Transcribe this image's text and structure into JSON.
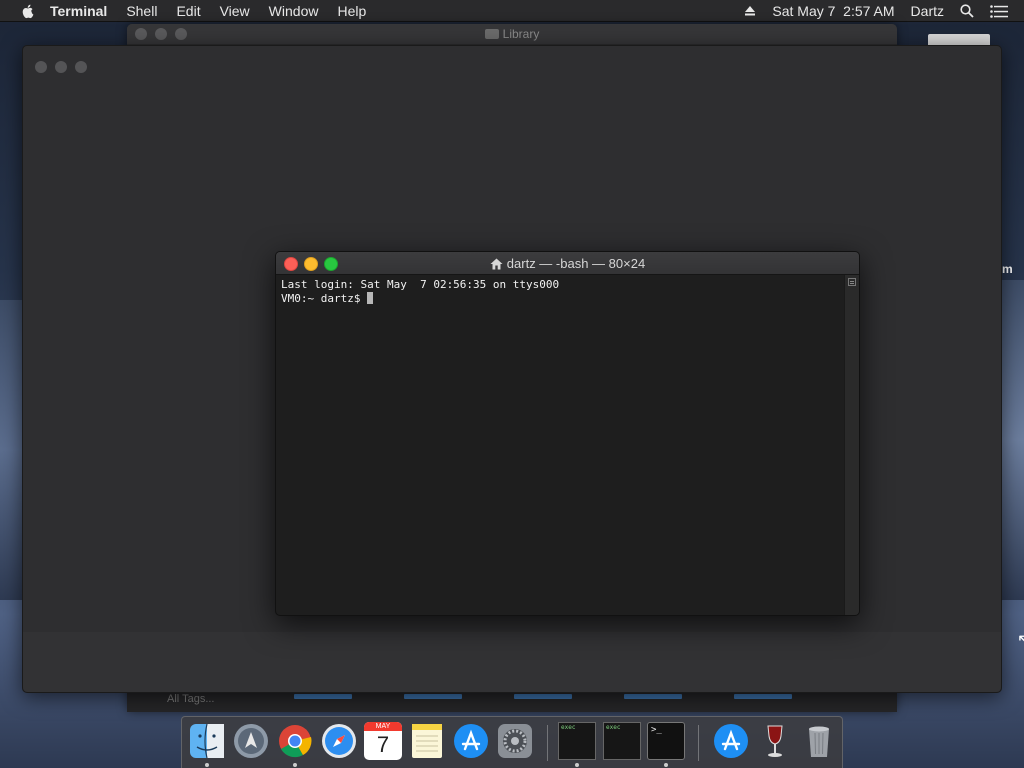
{
  "menubar": {
    "app_name": "Terminal",
    "menus": [
      "Shell",
      "Edit",
      "View",
      "Window",
      "Help"
    ],
    "datetime": "Sat May 7  2:57 AM",
    "user": "Dartz"
  },
  "library_window": {
    "title": "Library",
    "footer_label": "All Tags..."
  },
  "terminal": {
    "title": "dartz — -bash — 80×24",
    "lines": [
      "Last login: Sat May  7 02:56:35 on ttys000",
      "VM0:~ dartz$ "
    ]
  },
  "dock": {
    "items": [
      "Finder",
      "Launchpad",
      "Google Chrome",
      "Safari",
      "Calendar",
      "Notes",
      "App Store",
      "System Preferences",
      "exec",
      "exec",
      "Terminal",
      "App Store",
      "Wine",
      "Trash"
    ],
    "calendar_month": "MAY",
    "calendar_day": "7",
    "exec_label": "exec",
    "terminal_glyph": ">_"
  },
  "colors": {
    "close": "#fc5f57",
    "minimize": "#fdbc2e",
    "maximize": "#28c840",
    "terminal_bg": "#1e1e1e"
  }
}
